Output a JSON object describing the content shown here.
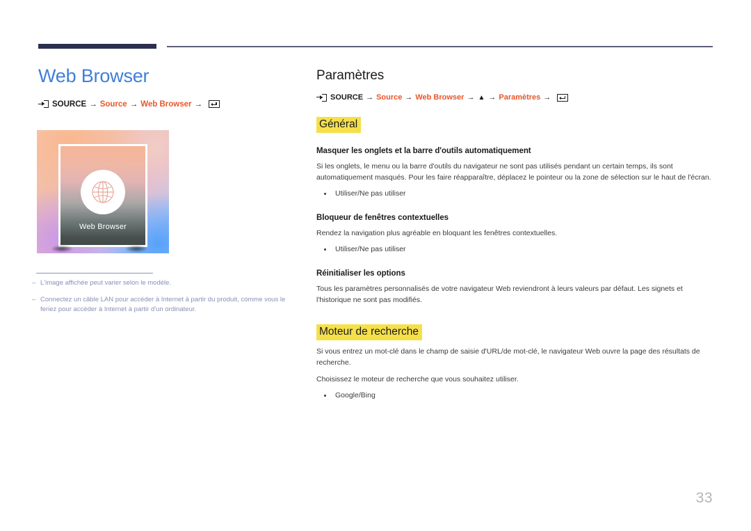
{
  "page": {
    "number": "33",
    "accent_blue": "#3f7fd8",
    "accent_red": "#e8562a",
    "highlight_yellow": "#f5e04a",
    "rule_navy": "#2b3050"
  },
  "left": {
    "chapter_title": "Web Browser",
    "breadcrumb": {
      "source_label": "SOURCE",
      "arrow": "→",
      "items": [
        {
          "text": "Source",
          "style": "red"
        },
        {
          "text": "Web Browser",
          "style": "red"
        }
      ],
      "source_icon": "source-input-icon",
      "enter_icon": "enter-key-icon"
    },
    "thumbnail": {
      "screen_label": "Web Browser",
      "icon": "globe-icon"
    },
    "notes": [
      {
        "dash": "–",
        "text": "L'image affichée peut varier selon le modèle."
      },
      {
        "dash": "–",
        "text": "Connectez un câble LAN pour accéder à Internet à partir du produit, comme vous le feriez pour accéder à Internet à partir d'un ordinateur."
      }
    ]
  },
  "right": {
    "section_title": "Paramètres",
    "breadcrumb": {
      "source_label": "SOURCE",
      "arrow": "→",
      "triangle": "▲",
      "items": [
        {
          "text": "Source",
          "style": "red"
        },
        {
          "text": "Web Browser",
          "style": "red"
        },
        {
          "text": "Paramètres",
          "style": "red"
        }
      ],
      "source_icon": "source-input-icon",
      "enter_icon": "enter-key-icon"
    },
    "group_general": {
      "heading": "Général",
      "sections": [
        {
          "heading": "Masquer les onglets et la barre d'outils automatiquement",
          "body": "Si les onglets, le menu ou la barre d'outils du navigateur ne sont pas utilisés pendant un certain temps, ils sont automatiquement masqués. Pour les faire réapparaître, déplacez le pointeur ou la zone de sélection sur le haut de l'écran.",
          "bullets": [
            "Utiliser/Ne pas utiliser"
          ]
        },
        {
          "heading": "Bloqueur de fenêtres contextuelles",
          "body": "Rendez la navigation plus agréable en bloquant les fenêtres contextuelles.",
          "bullets": [
            "Utiliser/Ne pas utiliser"
          ]
        },
        {
          "heading": "Réinitialiser les options",
          "body": "Tous les paramètres personnalisés de votre navigateur Web reviendront à leurs valeurs par défaut. Les signets et l'historique ne sont pas modifiés.",
          "bullets": []
        }
      ]
    },
    "group_search": {
      "heading": "Moteur de recherche",
      "body1": "Si vous entrez un mot-clé dans le champ de saisie d'URL/de mot-clé, le navigateur Web ouvre la page des résultats de recherche.",
      "body2": "Choisissez le moteur de recherche que vous souhaitez utiliser.",
      "bullets": [
        "Google/Bing"
      ]
    }
  }
}
